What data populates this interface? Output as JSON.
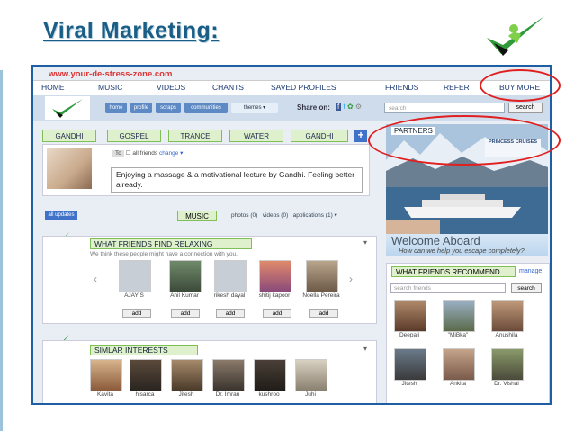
{
  "slide": {
    "title": "Viral Marketing:"
  },
  "site": {
    "url": "www.your-de-stress-zone.com"
  },
  "nav": [
    "HOME",
    "MUSIC",
    "VIDEOS",
    "CHANTS",
    "SAVED PROFILES",
    "FRIENDS",
    "REFER",
    "BUY MORE"
  ],
  "header": {
    "tabs": [
      "home",
      "profile",
      "scraps",
      "communities",
      "themes ▾"
    ],
    "share_label": "Share on:",
    "search_placeholder": "search",
    "search_button": "search"
  },
  "genre_tabs": [
    "GANDHI",
    "GOSPEL",
    "TRANCE",
    "WATER",
    "GANDHI"
  ],
  "partners": {
    "label": "PARTNERS",
    "brand": "PRINCESS CRUISES",
    "headline": "Welcome Aboard",
    "tagline": "How can we help you escape completely?"
  },
  "status": {
    "to_label": "To",
    "audience": "all friends",
    "change": "change ▾",
    "text": "Enjoying a massage & a motivational lecture by Gandhi. Feeling better already."
  },
  "updates": {
    "all_updates": "all updates",
    "music_label": "MUSIC",
    "media": [
      "photos (0)",
      "videos (0)",
      "applications (1) ▾"
    ]
  },
  "relaxing": {
    "label": "WHAT FRIENDS FIND RELAXING",
    "subtitle": "We think these people might have a connection with you.",
    "people": [
      "AJAY S",
      "Anil Kumar",
      "rikesh dayal",
      "shitij kapoor",
      "Noella Pereira"
    ],
    "add_label": "add"
  },
  "similar": {
    "label": "SIMLAR INTERESTS",
    "people": [
      "Kavita",
      "hisarca",
      "Jitesh",
      "Dr. Imran",
      "kushroo",
      "Juhi"
    ]
  },
  "recommend": {
    "label": "WHAT FRIENDS RECOMMEND",
    "manage": "manage",
    "search_placeholder": "search friends",
    "search_button": "search",
    "people": [
      "Deepali",
      "\"MiBka\"",
      "Anushila",
      "Jitesh",
      "Ankita",
      "Dr. Vishal"
    ]
  },
  "colors": {
    "accent": "#1e5fa3",
    "highlight": "#e02020",
    "tab_green": "#dff0cc",
    "logo_green": "#2e9a3a"
  }
}
